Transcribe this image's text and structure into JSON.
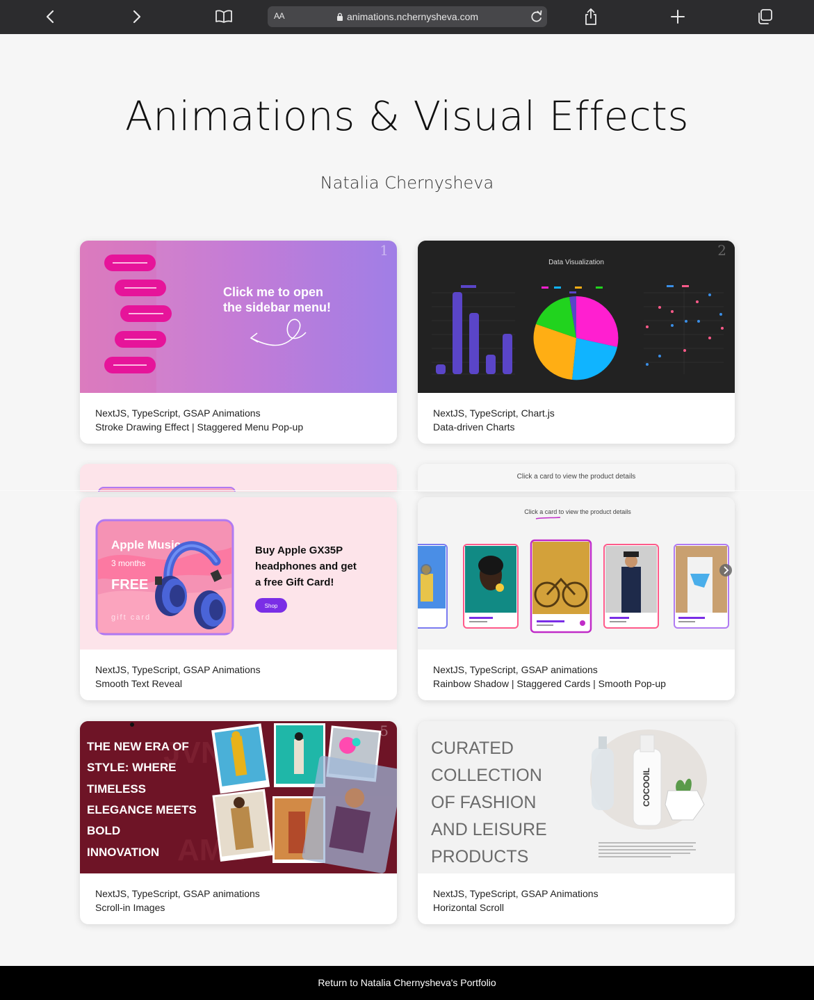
{
  "browser": {
    "text_size_label": "AA",
    "url": "animations.nchernysheva.com"
  },
  "header": {
    "title": "Animations & Visual Effects",
    "author": "Natalia Chernysheva"
  },
  "cards": [
    {
      "number": "1",
      "tech": "NextJS, TypeScript, GSAP Animations",
      "desc": "Stroke Drawing Effect | Staggered Menu Pop-up",
      "preview_text": "Click me to open the sidebar menu!",
      "preview_text_line1": "Click me to open",
      "preview_text_line2": "the sidebar menu!"
    },
    {
      "number": "2",
      "tech": "NextJS, TypeScript, Chart.js",
      "desc": "Data-driven Charts",
      "preview_title": "Data Visualization"
    },
    {
      "tech": "NextJS, TypeScript, GSAP Animations",
      "desc": "Smooth Text Reveal",
      "promo_app": "Apple Music",
      "promo_months": "3 months",
      "promo_free": "FREE",
      "promo_gift": "gift card",
      "promo_headline_1": "Buy Apple GX35P",
      "promo_headline_2": "headphones and get",
      "promo_headline_3": "a free Gift Card!",
      "promo_button": "Shop"
    },
    {
      "tech": "NextJS, TypeScript, GSAP animations",
      "desc": "Rainbow Shadow | Staggered Cards | Smooth Pop-up",
      "hint": "Click a card to view the product details"
    },
    {
      "number": "5",
      "tech": "NextJS, TypeScript, GSAP animations",
      "desc": "Scroll-in Images",
      "headline_lines": [
        "THE NEW ERA OF",
        "STYLE: WHERE",
        "TIMELESS",
        "ELEGANCE MEETS",
        "BOLD",
        "INNOVATION"
      ]
    },
    {
      "tech": "NextJS, TypeScript, GSAP Animations",
      "desc": "Horizontal Scroll",
      "headline_lines": [
        "CURATED",
        "COLLECTION",
        "OF FASHION",
        "AND LEISURE",
        "PRODUCTS"
      ],
      "bottle_label": "COCOOIL"
    }
  ],
  "footer": {
    "link": "Return to Natalia Chernysheva's Portfolio"
  },
  "colors": {
    "topbar": "#2c2c2e",
    "urlbar": "#47474a",
    "page_bg": "#f6f6f6",
    "footer_bg": "#000000",
    "accent_pink": "#e6149a",
    "accent_purple": "#7a2ee6",
    "maroon": "#6e1426"
  }
}
